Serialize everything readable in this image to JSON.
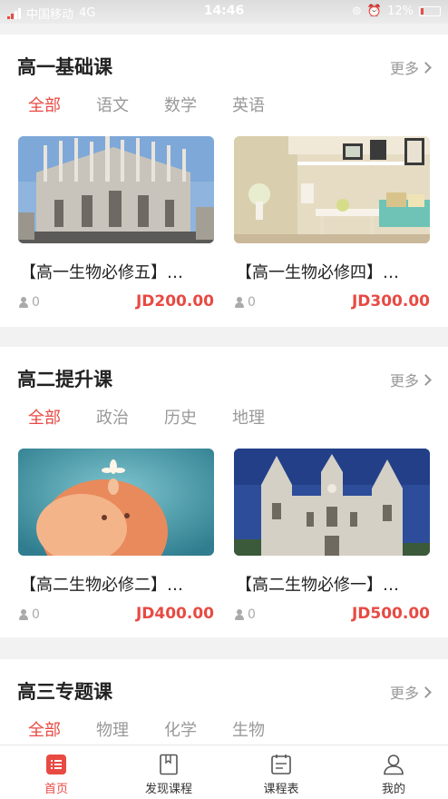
{
  "status_bar": {
    "carrier": "中国移动",
    "network": "4G",
    "time": "14:46",
    "battery": "12%"
  },
  "sections": [
    {
      "title": "高一基础课",
      "more": "更多",
      "tabs": [
        "全部",
        "语文",
        "数学",
        "英语"
      ],
      "courses": [
        {
          "title": "【高一生物必修五】…",
          "students": "0",
          "price": "JD200.00",
          "image": "cathedral-photo"
        },
        {
          "title": "【高一生物必修四】…",
          "students": "0",
          "price": "JD300.00",
          "image": "interior-photo"
        }
      ]
    },
    {
      "title": "高二提升课",
      "more": "更多",
      "tabs": [
        "全部",
        "政治",
        "历史",
        "地理"
      ],
      "courses": [
        {
          "title": "【高二生物必修二】…",
          "students": "0",
          "price": "JD400.00",
          "image": "illustration-photo"
        },
        {
          "title": "【高二生物必修一】…",
          "students": "0",
          "price": "JD500.00",
          "image": "church-photo"
        }
      ]
    },
    {
      "title": "高三专题课",
      "more": "更多",
      "tabs": [
        "全部",
        "物理",
        "化学",
        "生物"
      ]
    }
  ],
  "bottom_nav": [
    {
      "label": "首页",
      "icon": "home-icon",
      "active": true
    },
    {
      "label": "发现课程",
      "icon": "book-icon",
      "active": false
    },
    {
      "label": "课程表",
      "icon": "schedule-icon",
      "active": false
    },
    {
      "label": "我的",
      "icon": "profile-icon",
      "active": false
    }
  ],
  "colors": {
    "accent": "#e84a43",
    "muted": "#999999",
    "title": "#222222"
  }
}
